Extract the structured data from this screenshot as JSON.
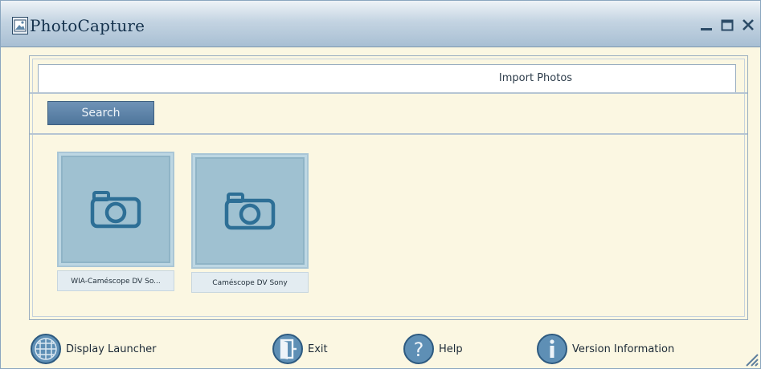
{
  "window": {
    "title": "PhotoCapture",
    "icon": "photo-app-icon",
    "controls": [
      {
        "name": "minimize",
        "icon": "minimize-icon"
      },
      {
        "name": "maximize",
        "icon": "maximize-icon"
      },
      {
        "name": "close",
        "icon": "close-icon"
      }
    ]
  },
  "panel": {
    "header_title": "Import Photos",
    "search_label": "Search"
  },
  "devices": [
    {
      "label": "WIA-Caméscope DV So...",
      "icon": "camera-icon"
    },
    {
      "label": "Caméscope DV Sony",
      "icon": "camera-icon"
    }
  ],
  "footer": {
    "display_launcher": "Display Launcher",
    "exit": "Exit",
    "help": "Help",
    "version_information": "Version Information"
  },
  "colors": {
    "window_bg": "#fbf7e2",
    "accent": "#4e759b",
    "icon_blue": "#2d6f96",
    "device_tile": "#9fc1d1"
  }
}
